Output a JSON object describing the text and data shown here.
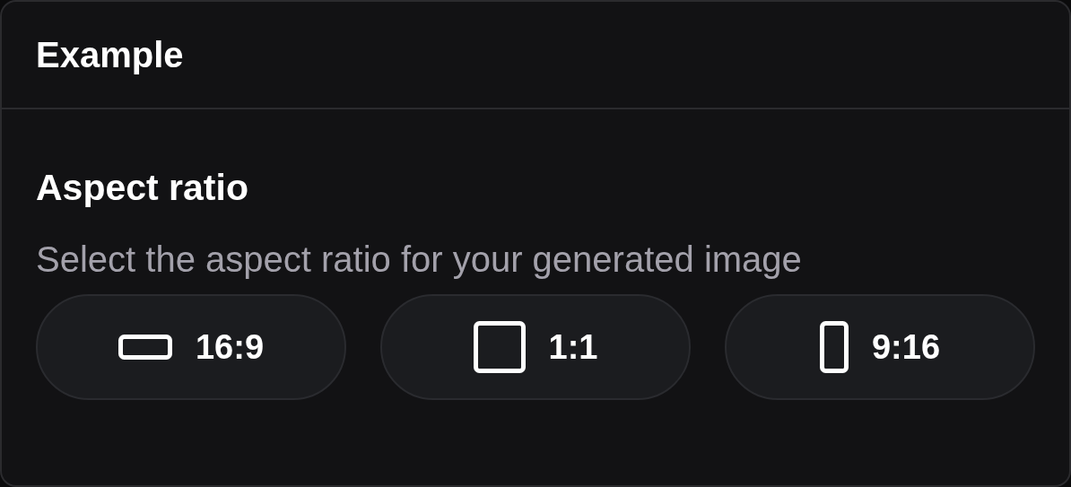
{
  "card": {
    "title": "Example"
  },
  "section": {
    "heading": "Aspect ratio",
    "description": "Select the aspect ratio for your generated image"
  },
  "options": [
    {
      "kind": "landscape",
      "label": "16:9",
      "selected": false
    },
    {
      "kind": "square",
      "label": "1:1",
      "selected": false
    },
    {
      "kind": "portrait",
      "label": "9:16",
      "selected": false
    }
  ]
}
